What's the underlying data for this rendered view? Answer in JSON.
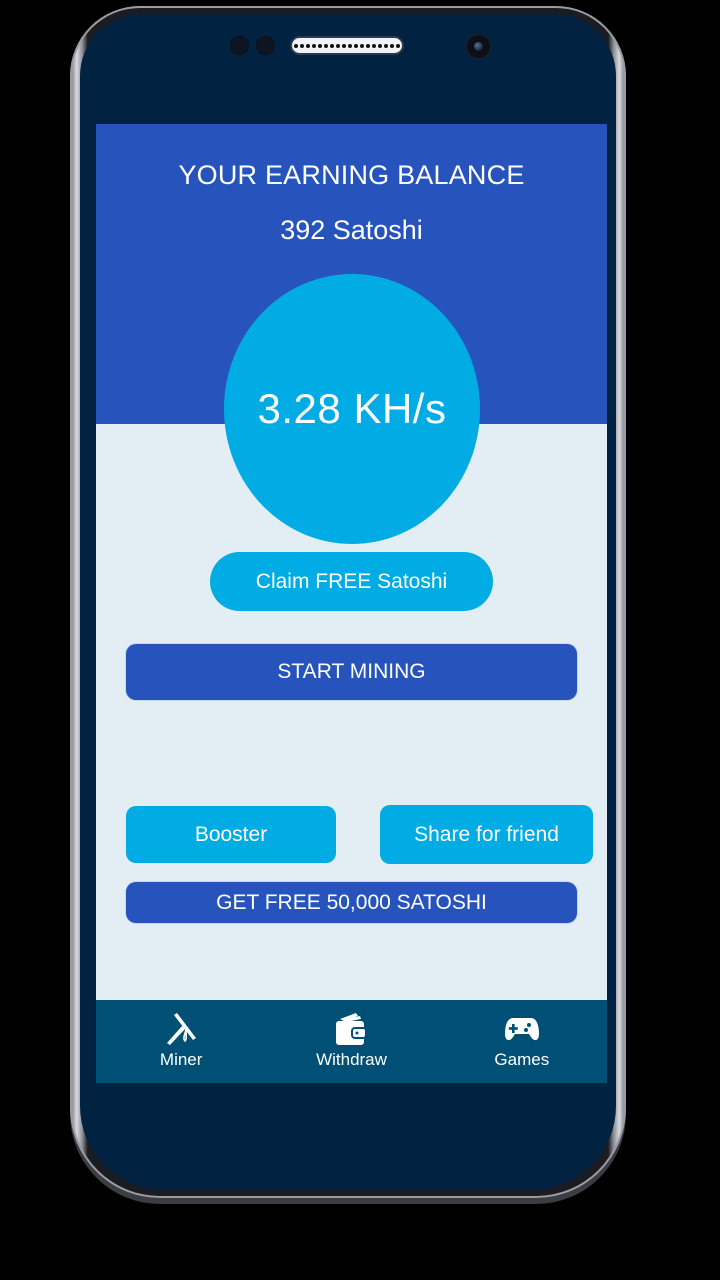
{
  "balance": {
    "title": "YOUR EARNING BALANCE",
    "value": "392 Satoshi"
  },
  "hashrate": {
    "value": "3.28 KH/s"
  },
  "actions": {
    "claim_label": "Claim FREE Satoshi",
    "start_mining_label": "START MINING",
    "booster_label": "Booster",
    "share_label": "Share for friend",
    "get_free_label": "GET FREE 50,000 SATOSHI"
  },
  "bottom_nav": {
    "items": [
      {
        "label": "Miner",
        "icon": "pickaxe-icon"
      },
      {
        "label": "Withdraw",
        "icon": "wallet-icon"
      },
      {
        "label": "Games",
        "icon": "gamepad-icon"
      }
    ]
  },
  "colors": {
    "header_blue": "#2754bc",
    "accent_cyan": "#00ace3",
    "nav_bg": "#004f75",
    "screen_bg": "#e2edf4"
  }
}
